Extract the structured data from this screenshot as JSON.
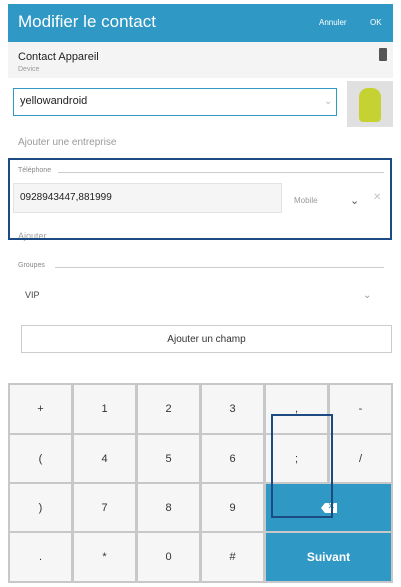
{
  "app_bar": {
    "title": "Modifier le contact",
    "cancel_label": "Annuler",
    "ok_label": "OK",
    "color": "#2f98c4"
  },
  "account": {
    "name": "Contact Appareil",
    "subtitle": "Device",
    "icon": "phone-icon"
  },
  "contact": {
    "name_value": "yellowandroid",
    "photo": "android-avatar"
  },
  "company": {
    "add_label": "Ajouter une entreprise"
  },
  "phone_section": {
    "label": "Téléphone",
    "number_value": "0928943447,881999",
    "type": "Mobile",
    "add_label": "Ajouter"
  },
  "groups_section": {
    "label": "Groupes",
    "value": "VIP"
  },
  "add_field_label": "Ajouter un champ",
  "keypad": {
    "row1": [
      "+",
      "1",
      "2",
      "3",
      ",",
      "-"
    ],
    "row2": [
      "(",
      "4",
      "5",
      "6",
      ";",
      "/"
    ],
    "row3": [
      ")",
      "7",
      "8",
      "9"
    ],
    "row4": [
      ".",
      "*",
      "0",
      "#"
    ],
    "next_label": "Suivant",
    "backspace_icon": "backspace-icon"
  }
}
